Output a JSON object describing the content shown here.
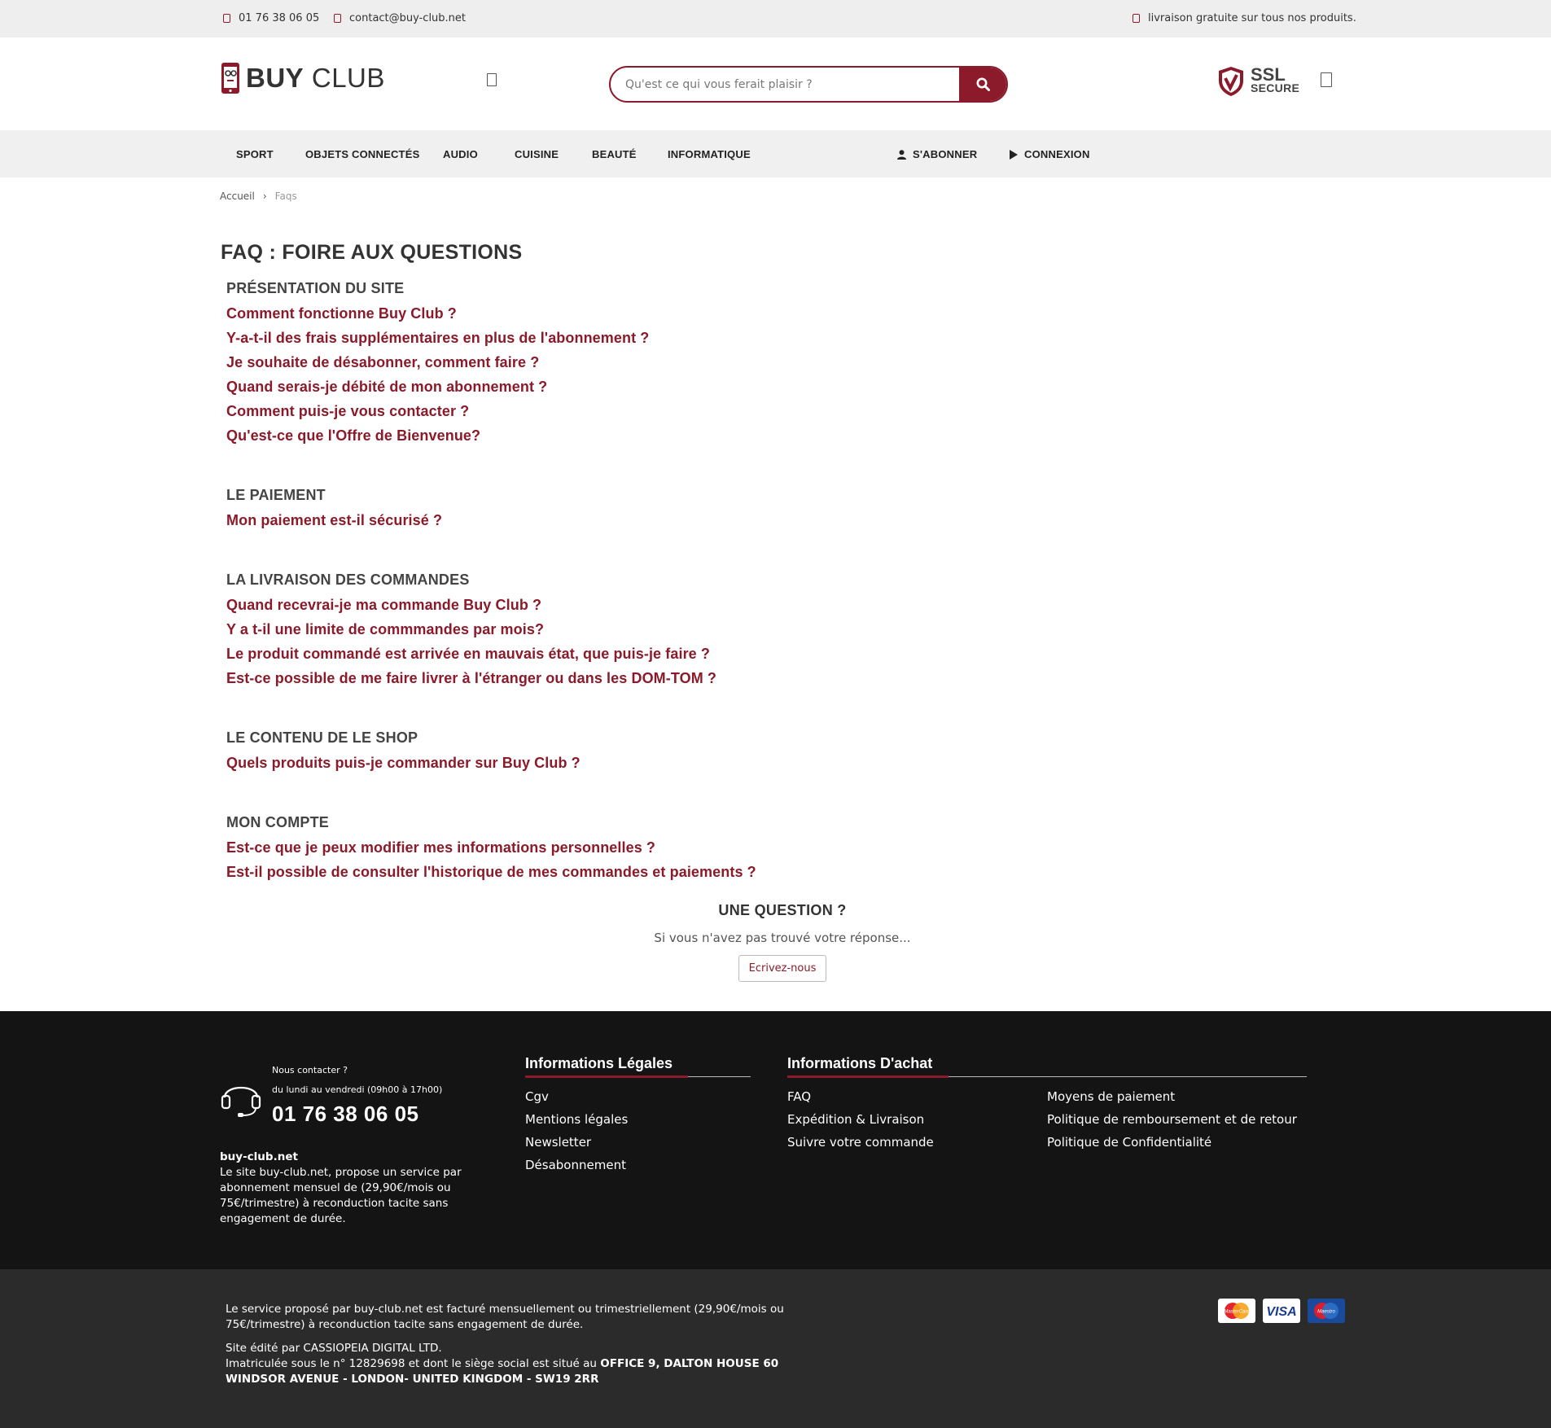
{
  "topbar": {
    "phone": "01 76 38 06 05",
    "email": "contact@buy-club.net",
    "shipping": "livraison gratuite sur tous nos produits."
  },
  "header": {
    "logo_bold": "BUY",
    "logo_light": "CLUB",
    "search_placeholder": "Qu'est ce qui vous ferait plaisir ?",
    "ssl_line1": "SSL",
    "ssl_line2": "SECURE"
  },
  "nav": {
    "items": [
      "SPORT",
      "OBJETS CONNECTÉS",
      "AUDIO",
      "CUISINE",
      "BEAUTÉ",
      "INFORMATIQUE"
    ],
    "subscribe": "S'ABONNER",
    "login": "CONNEXION"
  },
  "breadcrumb": {
    "home": "Accueil",
    "sep": "›",
    "current": "Faqs"
  },
  "page_title": "FAQ : FOIRE AUX QUESTIONS",
  "faq": [
    {
      "title": "PRÉSENTATION DU SITE",
      "questions": [
        "Comment fonctionne Buy Club ?",
        "Y-a-t-il des frais supplémentaires en plus de l'abonnement ?",
        "Je souhaite de désabonner, comment faire ?",
        "Quand serais-je débité de mon abonnement ?",
        "Comment puis-je vous contacter ?",
        "Qu'est-ce que l'Offre de Bienvenue?"
      ]
    },
    {
      "title": "LE PAIEMENT",
      "questions": [
        "Mon paiement est-il sécurisé ?"
      ]
    },
    {
      "title": "LA LIVRAISON DES COMMANDES",
      "questions": [
        "Quand recevrai-je ma commande Buy Club ?",
        "Y a t-il une limite de commmandes par mois?",
        "Le produit commandé est arrivée en mauvais état, que puis-je faire ?",
        "Est-ce possible de me faire livrer à l'étranger ou dans les DOM-TOM ?"
      ]
    },
    {
      "title": "LE CONTENU DE LE SHOP",
      "questions": [
        "Quels produits puis-je commander sur Buy Club ?"
      ]
    },
    {
      "title": "MON COMPTE",
      "questions": [
        "Est-ce que je peux modifier mes informations personnelles ?",
        "Est-il possible de consulter l'historique de mes commandes et paiements ?"
      ]
    }
  ],
  "ask": {
    "title": "UNE QUESTION ?",
    "subtitle": "Si vous n'avez pas trouvé votre réponse...",
    "button": "Ecrivez-nous"
  },
  "footer": {
    "contact_label": "Nous contacter ?",
    "contact_hours": "du lundi au vendredi (09h00 à 17h00)",
    "contact_phone": "01 76 38 06 05",
    "about_title": "buy-club.net",
    "about_text": "Le site buy-club.net, propose un service par abonnement mensuel de (29,90€/mois ou 75€/trimestre) à reconduction tacite sans engagement de durée.",
    "legal_title": "Informations Légales",
    "legal_links": [
      "Cgv",
      "Mentions légales",
      "Newsletter",
      "Désabonnement"
    ],
    "purchase_title": "Informations D'achat",
    "purchase_links_col1": [
      "FAQ",
      "Expédition & Livraison",
      "Suivre votre commande"
    ],
    "purchase_links_col2": [
      "Moyens de paiement",
      "Politique de remboursement et de retour",
      "Politique de Confidentialité"
    ]
  },
  "bottom": {
    "billing_text": "Le service proposé par buy-club.net est facturé mensuellement ou trimestriellement (29,90€/mois ou 75€/trimestre) à reconduction tacite sans engagement de durée.",
    "editor_text": "Site édité par CASSIOPEIA DIGITAL LTD.",
    "registration_text": "Imatriculée sous le n° 12829698 et dont le siège social est situé au",
    "address_text": "OFFICE 9, DALTON HOUSE 60 WINDSOR AVENUE - LONDON- UNITED KINGDOM - SW19 2RR",
    "payment_cards": [
      "MasterCard",
      "VISA",
      "Maestro"
    ]
  },
  "colors": {
    "brand": "#8b1a2a",
    "footer_bg": "#141414",
    "bottom_bg": "#2b2b2b",
    "nav_bg": "#f0f0f0"
  }
}
